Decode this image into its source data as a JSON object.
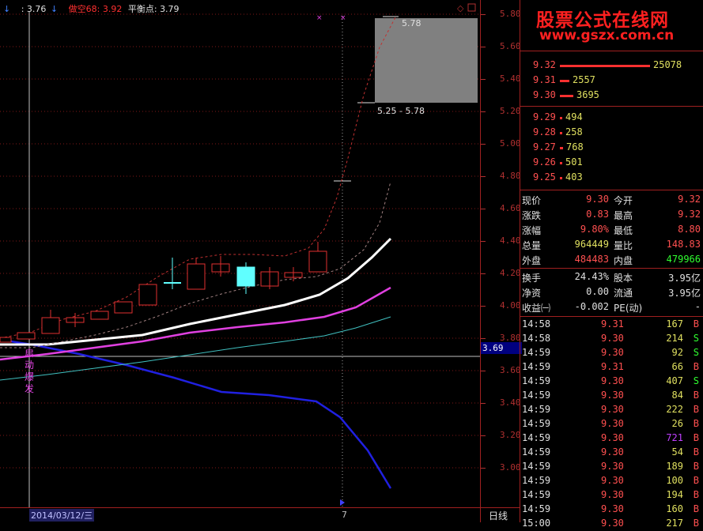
{
  "header": {
    "arrow_left": "↓",
    "current": ": 3.76",
    "arrow_right": "↓",
    "indicator_label": "做空68:",
    "indicator_value": "3.92",
    "balance_label": "平衡点:",
    "balance_value": "3.79"
  },
  "watermark": {
    "title": "股票公式在线网",
    "url": "www.gszx.com.cn"
  },
  "price_axis": [
    "5.80",
    "5.60",
    "5.40",
    "5.20",
    "5.00",
    "4.80",
    "4.60",
    "4.40",
    "4.20",
    "4.00",
    "3.80",
    "3.60",
    "3.40",
    "3.20",
    "3.00"
  ],
  "crosshair_price": "3.69",
  "annotations": {
    "range_top": "5.78",
    "range_label": "5.25 - 5.78",
    "vertical_text": [
      "启",
      "动",
      "爆",
      "发"
    ]
  },
  "bottom": {
    "date_label": "2014/03/12/三",
    "marker": "7",
    "period_label": "日线"
  },
  "sell_orders": [
    {
      "price": "9.32",
      "volume": "25078",
      "bar": 0.95
    },
    {
      "price": "9.31",
      "volume": "2557",
      "bar": 0.1
    },
    {
      "price": "9.30",
      "volume": "3695",
      "bar": 0.14
    }
  ],
  "buy_orders": [
    {
      "price": "9.29",
      "volume": "494",
      "bar": 0.02
    },
    {
      "price": "9.28",
      "volume": "258",
      "bar": 0.01
    },
    {
      "price": "9.27",
      "volume": "768",
      "bar": 0.03
    },
    {
      "price": "9.26",
      "volume": "501",
      "bar": 0.02
    },
    {
      "price": "9.25",
      "volume": "403",
      "bar": 0.015
    }
  ],
  "quote": [
    {
      "l1": "现价",
      "v1": "9.30",
      "c1": "red",
      "l2": "今开",
      "v2": "9.32",
      "c2": "red"
    },
    {
      "l1": "涨跌",
      "v1": "0.83",
      "c1": "red",
      "l2": "最高",
      "v2": "9.32",
      "c2": "red"
    },
    {
      "l1": "涨幅",
      "v1": "9.80%",
      "c1": "red",
      "l2": "最低",
      "v2": "8.80",
      "c2": "red"
    },
    {
      "l1": "总量",
      "v1": "964449",
      "c1": "yellow",
      "l2": "量比",
      "v2": "148.83",
      "c2": "red"
    },
    {
      "l1": "外盘",
      "v1": "484483",
      "c1": "red",
      "l2": "内盘",
      "v2": "479966",
      "c2": "green"
    }
  ],
  "fundamentals": [
    {
      "l1": "换手",
      "v1": "24.43%",
      "l2": "股本",
      "v2": "3.95亿"
    },
    {
      "l1": "净资",
      "v1": "0.00",
      "l2": "流通",
      "v2": "3.95亿"
    },
    {
      "l1": "收益㈠",
      "v1": "-0.002",
      "l2": "PE(动)",
      "v2": "-"
    }
  ],
  "ticks": [
    {
      "time": "14:58",
      "price": "9.31",
      "vol": "167",
      "side": "B",
      "vc": "yellow"
    },
    {
      "time": "14:58",
      "price": "9.30",
      "vol": "214",
      "side": "S",
      "vc": "yellow"
    },
    {
      "time": "14:59",
      "price": "9.30",
      "vol": "92",
      "side": "S",
      "vc": "yellow"
    },
    {
      "time": "14:59",
      "price": "9.31",
      "vol": "66",
      "side": "B",
      "vc": "yellow"
    },
    {
      "time": "14:59",
      "price": "9.30",
      "vol": "407",
      "side": "S",
      "vc": "yellow"
    },
    {
      "time": "14:59",
      "price": "9.30",
      "vol": "84",
      "side": "B",
      "vc": "yellow"
    },
    {
      "time": "14:59",
      "price": "9.30",
      "vol": "222",
      "side": "B",
      "vc": "yellow"
    },
    {
      "time": "14:59",
      "price": "9.30",
      "vol": "26",
      "side": "B",
      "vc": "yellow"
    },
    {
      "time": "14:59",
      "price": "9.30",
      "vol": "721",
      "side": "B",
      "vc": "purple"
    },
    {
      "time": "14:59",
      "price": "9.30",
      "vol": "54",
      "side": "B",
      "vc": "yellow"
    },
    {
      "time": "14:59",
      "price": "9.30",
      "vol": "189",
      "side": "B",
      "vc": "yellow"
    },
    {
      "time": "14:59",
      "price": "9.30",
      "vol": "100",
      "side": "B",
      "vc": "yellow"
    },
    {
      "time": "14:59",
      "price": "9.30",
      "vol": "194",
      "side": "B",
      "vc": "yellow"
    },
    {
      "time": "14:59",
      "price": "9.30",
      "vol": "160",
      "side": "B",
      "vc": "yellow"
    },
    {
      "time": "15:00",
      "price": "9.30",
      "vol": "217",
      "side": "B",
      "vc": "yellow"
    }
  ]
}
